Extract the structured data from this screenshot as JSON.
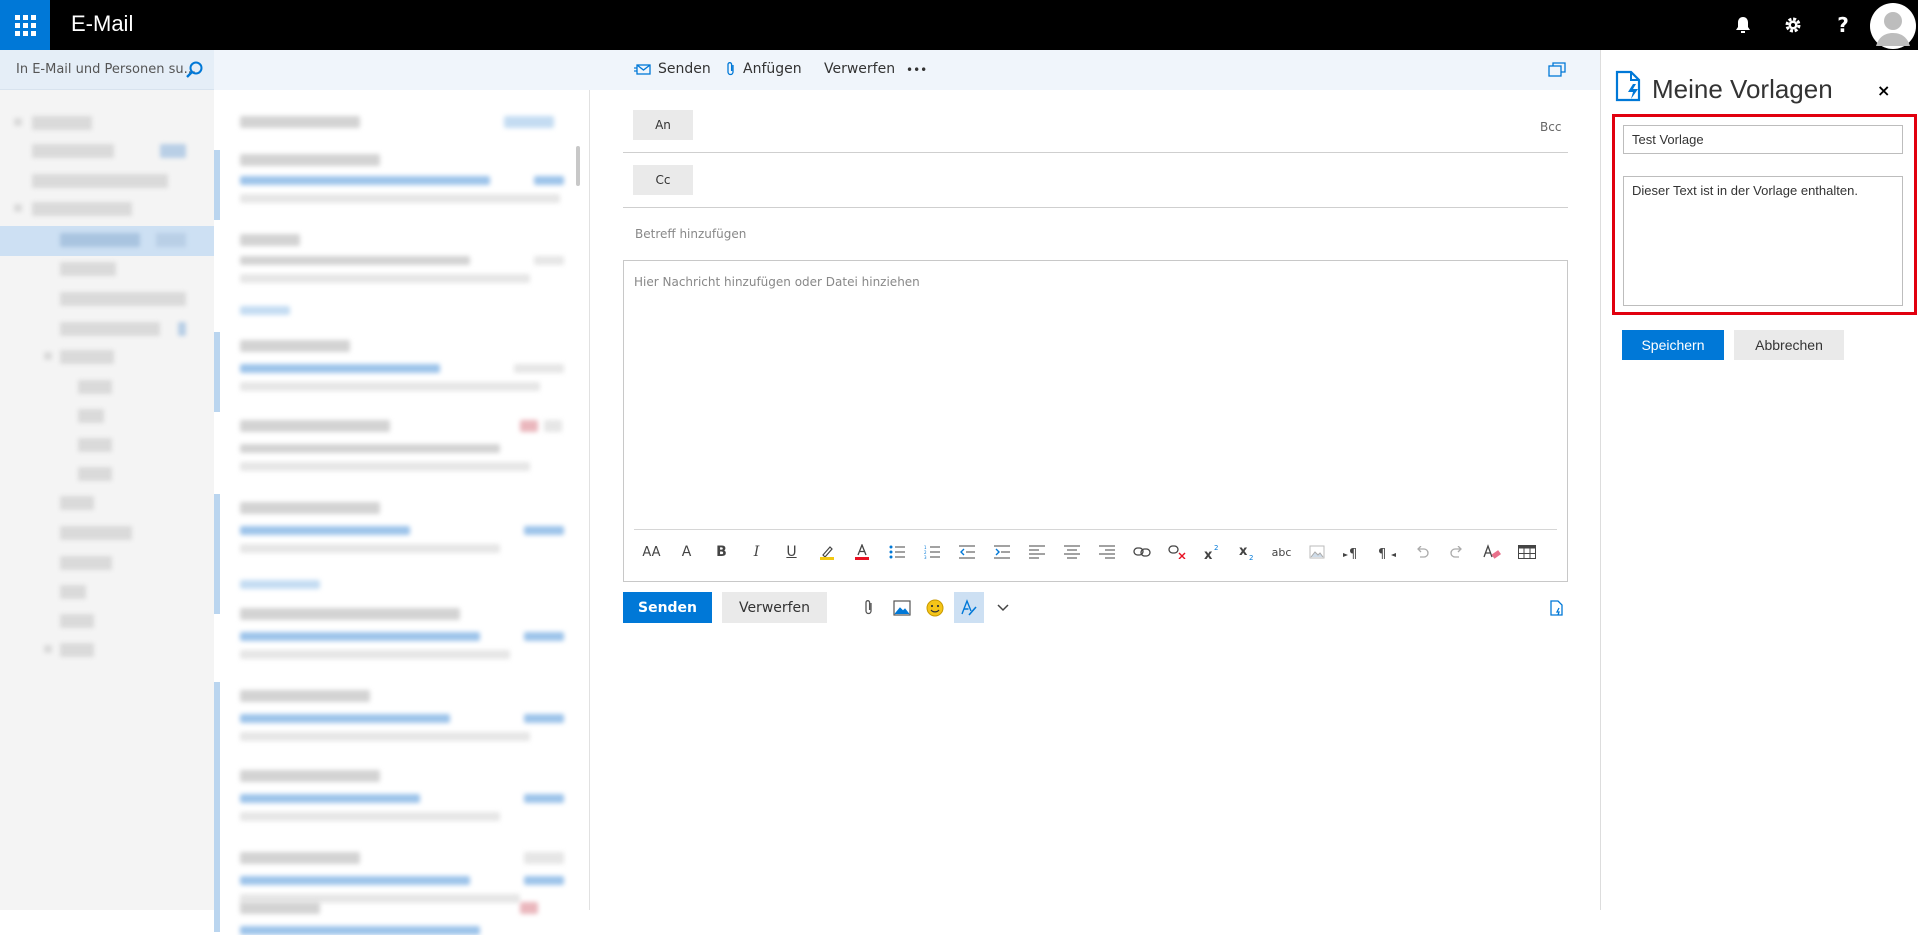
{
  "app": {
    "title": "E-Mail"
  },
  "search": {
    "placeholder": "In E-Mail und Personen su..."
  },
  "commandbar": {
    "send_label": "Senden",
    "attach_label": "Anfügen",
    "discard_label": "Verwerfen",
    "more_label": "•••"
  },
  "compose": {
    "to_label": "An",
    "cc_label": "Cc",
    "bcc_label": "Bcc",
    "subject_placeholder": "Betreff hinzufügen",
    "body_placeholder": "Hier Nachricht hinzufügen oder Datei hinziehen",
    "send_label": "Senden",
    "discard_label": "Verwerfen"
  },
  "templates": {
    "title": "Meine Vorlagen",
    "close_label": "×",
    "name_value": "Test Vorlage",
    "body_value": "Dieser Text ist in der Vorlage enthalten.",
    "save_label": "Speichern",
    "cancel_label": "Abbrechen"
  },
  "format_toolbar": {
    "font_size_label": "AA",
    "grow_label": "A",
    "bold_label": "B",
    "italic_label": "I",
    "underline_label": "U",
    "strikethrough_label": "abc"
  },
  "colors": {
    "accent": "#0078d7",
    "highlight_box": "#e1000f",
    "topbar": "#000000"
  }
}
